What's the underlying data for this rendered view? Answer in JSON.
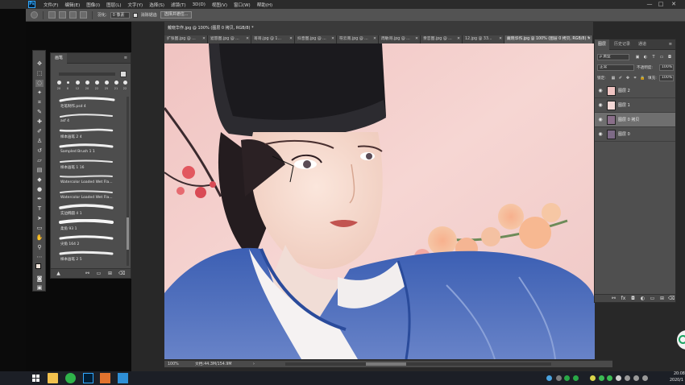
{
  "menubar": {
    "logo": "Ps",
    "items": [
      "文件(F)",
      "编辑(E)",
      "图像(I)",
      "图层(L)",
      "文字(Y)",
      "选择(S)",
      "滤镜(T)",
      "3D(D)",
      "视图(V)",
      "窗口(W)",
      "帮助(H)"
    ],
    "minimize": "—",
    "maximize": "□",
    "close": "✕"
  },
  "options": {
    "feather_label": "羽化:",
    "feather_value": "0 像素",
    "antialias_label": "消除锯齿",
    "select_mask_button": "选择并遮住..."
  },
  "brushes": {
    "tab": "画笔",
    "dot_sizes": [
      "20",
      "8",
      "12",
      "20",
      "22",
      "25",
      "21",
      "22"
    ],
    "items": [
      {
        "name": "毛笔制作.psd 4"
      },
      {
        "name": "asf 4"
      },
      {
        "name": "样本画笔 2 4"
      },
      {
        "name": "Sampled Brush 1 1"
      },
      {
        "name": "样本画笔 1 16"
      },
      {
        "name": "Watercolor Loaded Wet Fla..."
      },
      {
        "name": "Watercolor Loaded Wet Fla..."
      },
      {
        "name": "实边椭圆 4 1"
      },
      {
        "name": "柔角 93 1"
      },
      {
        "name": "尖角 164 2"
      },
      {
        "name": "样本画笔 2 5"
      }
    ]
  },
  "document": {
    "active_title": "戴晓华作.jpg @ 100% (图层 0 拷贝, RGB/8) *",
    "tabs": [
      {
        "label": "扩张图.jpg @ ..."
      },
      {
        "label": "遮怒图.jpg @ ..."
      },
      {
        "label": "哥哥.jpg @ 1..."
      },
      {
        "label": "抖音图.jpg @ ..."
      },
      {
        "label": "符云南.jpg @ ..."
      },
      {
        "label": "周敏哥.jpg @ ..."
      },
      {
        "label": "亲恋图.jpg @ ..."
      },
      {
        "label": "12.jpg @ 33..."
      },
      {
        "label": "戴晓华作.jpg @ 100% (图层 0 拷贝, RGB/8) *"
      }
    ],
    "tab_close": "✕"
  },
  "status": {
    "zoom": "100%",
    "doc_size": "文档:44.3M/154.9M",
    "arrow": "›"
  },
  "layers": {
    "tabs": [
      "图层",
      "历史记录",
      "通道"
    ],
    "filter_label": "ρ 类型",
    "blend_mode": "正常",
    "opacity_label": "不透明度:",
    "opacity_value": "100%",
    "lock_label": "锁定:",
    "fill_label": "填充:",
    "fill_value": "100%",
    "items": [
      {
        "name": "图层 2",
        "selected": false
      },
      {
        "name": "图层 1",
        "selected": false
      },
      {
        "name": "图层 0 拷贝",
        "selected": true
      },
      {
        "name": "图层 0",
        "selected": false
      }
    ]
  },
  "taskbar": {
    "clock_time": "20:08",
    "clock_date": "2020/1"
  },
  "colors": {
    "accent_blue": "#31a8ff",
    "panel_gray": "#4f4f4f",
    "selected_layer": "#6f6f6f"
  }
}
